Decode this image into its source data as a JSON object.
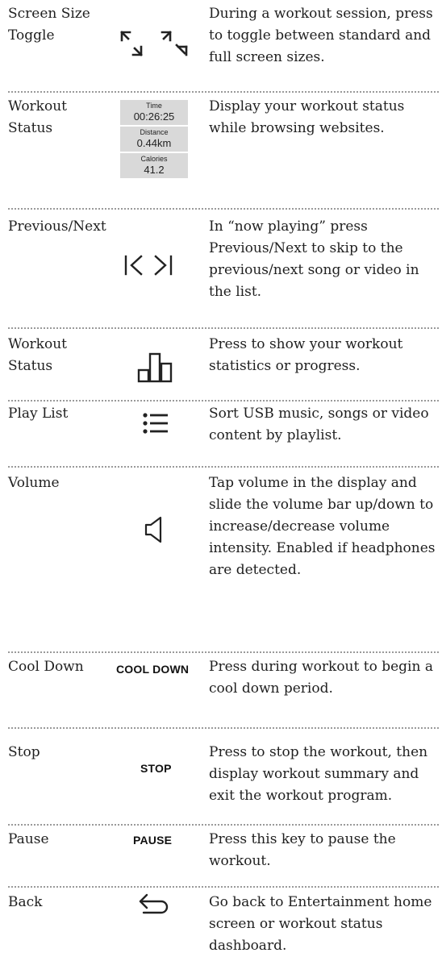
{
  "rows": [
    {
      "label": "Screen Size Toggle",
      "icon": "screen-size-toggle-icon",
      "description": "During a workout session, press to toggle between standard and full screen sizes."
    },
    {
      "label": "Workout Status",
      "icon": "workout-status-card",
      "description": "Display your workout status while browsing websites."
    },
    {
      "label": "Previous/Next",
      "icon": "previous-next-icon",
      "description": "In “now playing” press Previous/Next to skip to the previous/next song or video in the list."
    },
    {
      "label": "Workout Status",
      "icon": "bar-chart-icon",
      "description": "Press to show your workout statistics or progress."
    },
    {
      "label": "Play List",
      "icon": "list-icon",
      "description": "Sort USB music, songs or video content by playlist."
    },
    {
      "label": "Volume",
      "icon": "speaker-icon",
      "description": "Tap volume in the display and slide the volume bar up/down to increase/decrease volume intensity.  Enabled if headphones are detected."
    },
    {
      "label": "Cool Down",
      "icon_text": "COOL DOWN",
      "description": "Press during workout to begin a cool down period."
    },
    {
      "label": "Stop",
      "icon_text": "STOP",
      "description": "Press to stop the workout, then display workout summary and exit the workout program."
    },
    {
      "label": "Pause",
      "icon_text": "PAUSE",
      "description": "Press this key to pause the workout."
    },
    {
      "label": "Back",
      "icon": "back-arrow-icon",
      "description": "Go back to Entertainment home screen or workout status dashboard."
    }
  ],
  "status_card": {
    "time_label": "Time",
    "time_value": "00:26:25",
    "distance_label": "Distance",
    "distance_value": "0.44km",
    "calories_label": "Calories",
    "calories_value": "41.2"
  }
}
